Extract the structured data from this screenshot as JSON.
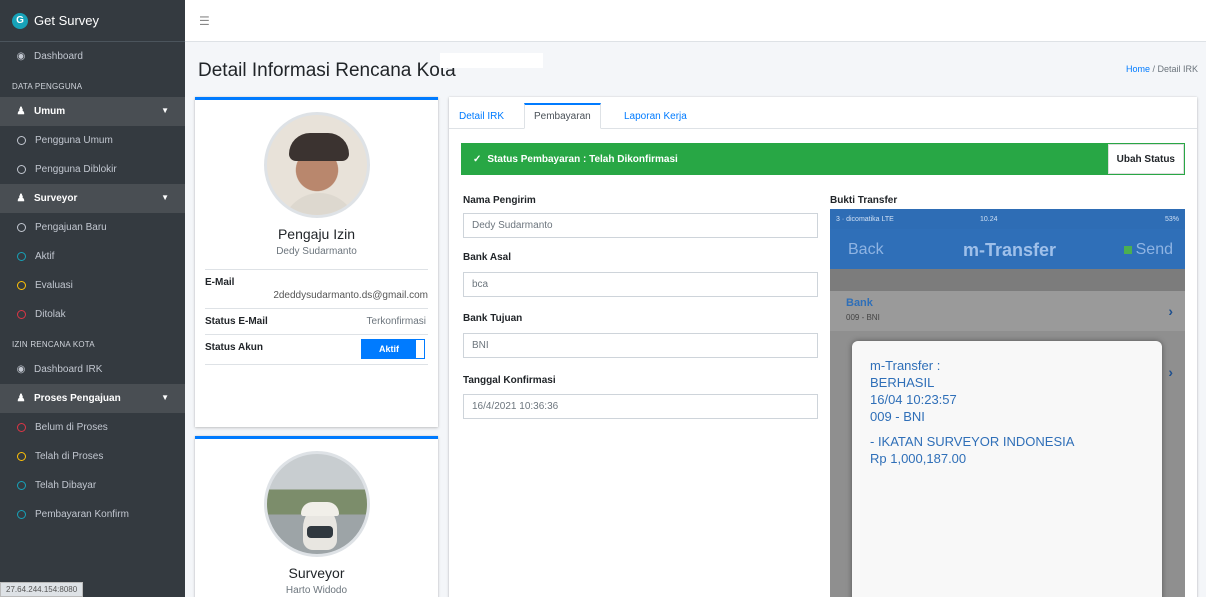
{
  "sidebar": {
    "brand": "Get Survey",
    "items": [
      {
        "type": "link",
        "icon": "tachometer-icon",
        "label": "Dashboard"
      },
      {
        "type": "header",
        "label": "DATA PENGGUNA"
      },
      {
        "type": "group",
        "icon": "user-icon",
        "label": "Umum"
      },
      {
        "type": "sub",
        "color": "#c2c7d0",
        "label": "Pengguna Umum"
      },
      {
        "type": "sub",
        "color": "#c2c7d0",
        "label": "Pengguna Diblokir"
      },
      {
        "type": "group",
        "icon": "users-icon",
        "label": "Surveyor"
      },
      {
        "type": "sub",
        "color": "#c2c7d0",
        "label": "Pengajuan Baru"
      },
      {
        "type": "sub",
        "color": "#17a2b8",
        "label": "Aktif"
      },
      {
        "type": "sub",
        "color": "#ffc107",
        "label": "Evaluasi"
      },
      {
        "type": "sub",
        "color": "#dc3545",
        "label": "Ditolak"
      },
      {
        "type": "header",
        "label": "IZIN RENCANA KOTA"
      },
      {
        "type": "link",
        "icon": "tachometer-icon",
        "label": "Dashboard IRK"
      },
      {
        "type": "group",
        "icon": "user-icon",
        "label": "Proses Pengajuan"
      },
      {
        "type": "sub",
        "color": "#dc3545",
        "label": "Belum di Proses"
      },
      {
        "type": "sub",
        "color": "#ffc107",
        "label": "Telah di Proses"
      },
      {
        "type": "sub",
        "color": "#17a2b8",
        "label": "Telah Dibayar"
      },
      {
        "type": "sub",
        "color": "#17a2b8",
        "label": "Pembayaran Konfirm"
      }
    ],
    "status_url": "27.64.244.154:8080"
  },
  "header": {
    "page_title": "Detail Informasi Rencana Kota",
    "breadcrumb_home": "Home",
    "breadcrumb_sep": " / ",
    "breadcrumb_current": "Detail IRK"
  },
  "applicant": {
    "role": "Pengaju Izin",
    "name": "Dedy Sudarmanto",
    "email_label": "E-Mail",
    "email": "2deddysudarmanto.ds@gmail.com",
    "email_status_label": "Status E-Mail",
    "email_status": "Terkonfirmasi",
    "account_status_label": "Status Akun",
    "account_status": "Aktif"
  },
  "surveyor": {
    "role": "Surveyor",
    "name": "Harto Widodo"
  },
  "tabs": [
    "Detail IRK",
    "Pembayaran",
    "Laporan Kerja"
  ],
  "alert": {
    "text": "Status Pembayaran : Telah Dikonfirmasi",
    "button": "Ubah Status"
  },
  "form": {
    "sender_label": "Nama Pengirim",
    "sender": "Dedy Sudarmanto",
    "bank_from_label": "Bank Asal",
    "bank_from": "bca",
    "bank_to_label": "Bank Tujuan",
    "bank_to": "BNI",
    "confirm_date_label": "Tanggal Konfirmasi",
    "confirm_date": "16/4/2021 10:36:36"
  },
  "transfer": {
    "label": "Bukti Transfer",
    "statusbar_left": "3 · dicomatika LTE",
    "statusbar_time": "10.24",
    "statusbar_right": "53%",
    "nav_back": "Back",
    "nav_title": "m-Transfer",
    "nav_send": "Send",
    "bank_title": "Bank",
    "bank_sub": "009 - BNI",
    "popup_lines": [
      "m-Transfer :",
      "BERHASIL",
      "16/04 10:23:57",
      "009 - BNI"
    ],
    "popup_lines2": [
      "- IKATAN SURVEYOR INDONESIA",
      "Rp 1,000,187.00"
    ]
  }
}
